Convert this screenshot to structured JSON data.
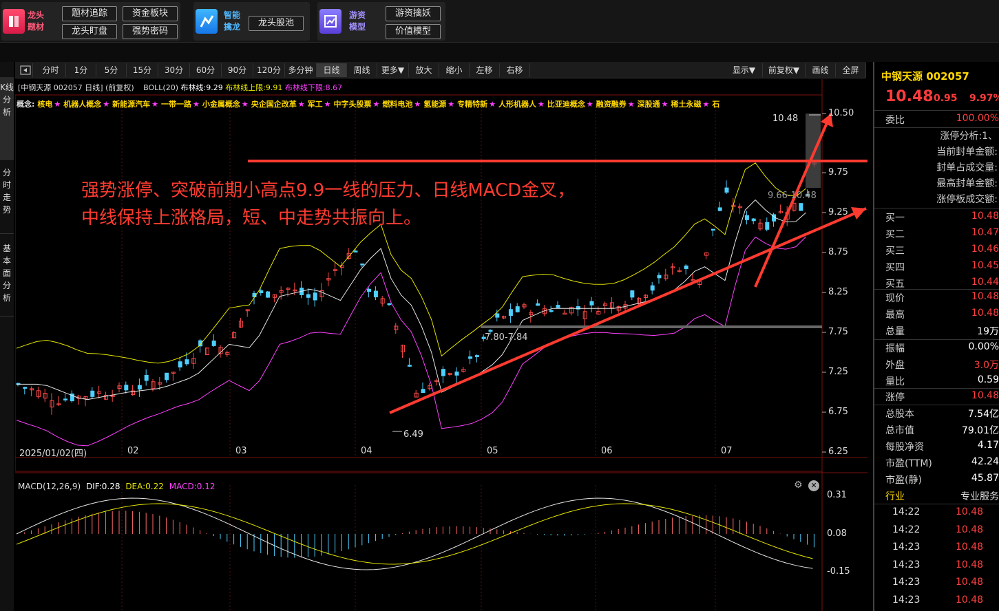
{
  "topbar": {
    "groups": [
      {
        "title": "龙头题材",
        "buttons": [
          "题材追踪",
          "资金板块",
          "龙头盯盘",
          "强势密码"
        ]
      },
      {
        "title": "智能擒龙",
        "buttons": [
          "龙头股池"
        ]
      },
      {
        "title": "游资模型",
        "buttons": [
          "游资擒妖",
          "价值模型"
        ]
      }
    ]
  },
  "sidetabs": [
    "K线分析",
    "分时走势",
    "基本面分析"
  ],
  "toolbar": {
    "left": [
      "分时",
      "1分",
      "5分",
      "15分",
      "30分",
      "60分",
      "90分",
      "120分",
      "多分钟",
      "日线",
      "周线",
      "更多▼",
      "放大",
      "缩小",
      "左移",
      "右移"
    ],
    "right": [
      "显示▼",
      "前复权▼",
      "画线",
      "全屏"
    ],
    "active": "日线"
  },
  "chart_info": {
    "header": "[中钢天源 002057 日线]  (前复权)",
    "boll": "BOLL(20)",
    "mid": "布林线:9.29",
    "upper": "布林线上限:9.91",
    "lower": "布林线下限:8.67"
  },
  "concepts": {
    "label": "概念:",
    "items": [
      "核电",
      "机器人概念",
      "新能源汽车",
      "一带一路",
      "小金属概念",
      "央企国企改革",
      "军工",
      "中字头股票",
      "燃料电池",
      "氢能源",
      "专精特新",
      "人形机器人",
      "比亚迪概念",
      "融资融券",
      "深股通",
      "稀土永磁",
      "石"
    ]
  },
  "annotation": {
    "line1": "强势涨停、突破前期小高点9.9一线的压力、日线MACD金叉，",
    "line2": "中线保持上涨格局，短、中走势共振向上。"
  },
  "price_labels": {
    "high": "10.48",
    "low": "6.49",
    "zone": "7.80-7.84",
    "ghost": "9.66-10.48"
  },
  "xaxis": {
    "first": "2025/01/02(四)",
    "months": [
      "02",
      "03",
      "04",
      "05",
      "06",
      "07"
    ]
  },
  "yaxis": [
    "10.50",
    "9.75",
    "9.25",
    "8.75",
    "8.25",
    "7.75",
    "7.25",
    "6.75",
    "6.25"
  ],
  "macd": {
    "label": "MACD(12,26,9)",
    "dif": "DIF:0.28",
    "dea": "DEA:0.22",
    "macd": "MACD:0.12",
    "ticks": [
      "0.31",
      "0.08",
      "-0.15"
    ]
  },
  "quote": {
    "name": "中钢天源 002057",
    "price": "10.48",
    "change": "0.95",
    "pct": "9.97%",
    "weibi_label": "委比",
    "weibi": "100.00%",
    "limit_lines": [
      "涨停分析:1、",
      "当前封单金额:",
      "封单占成交量:",
      "最高封单金额:",
      "涨停板成交额:"
    ],
    "book": [
      {
        "l": "买一",
        "v": "10.48"
      },
      {
        "l": "买二",
        "v": "10.47"
      },
      {
        "l": "买三",
        "v": "10.46"
      },
      {
        "l": "买四",
        "v": "10.45"
      },
      {
        "l": "买五",
        "v": "10.44"
      }
    ],
    "stats1": [
      {
        "l": "现价",
        "v": "10.48",
        "c": "#ff4040"
      },
      {
        "l": "最高",
        "v": "10.48",
        "c": "#ff4040"
      },
      {
        "l": "总量",
        "v": "19万",
        "c": "#ffffff"
      }
    ],
    "stats2": [
      {
        "l": "振幅",
        "v": "0.00%",
        "c": "#ffffff"
      },
      {
        "l": "外盘",
        "v": "3.0万",
        "c": "#ff4040"
      },
      {
        "l": "量比",
        "v": "0.59",
        "c": "#ffffff"
      }
    ],
    "stats3": [
      {
        "l": "涨停",
        "v": "10.48",
        "c": "#ff4040"
      }
    ],
    "fund": [
      {
        "l": "总股本",
        "v": "7.54亿"
      },
      {
        "l": "总市值",
        "v": "79.01亿"
      },
      {
        "l": "每股净资",
        "v": "4.17"
      },
      {
        "l": "市盈(TTM)",
        "v": "42.24"
      },
      {
        "l": "市盈(静)",
        "v": "45.87"
      }
    ],
    "industry_label": "行业",
    "industry": "专业服务",
    "ticks": [
      {
        "t": "14:22",
        "p": "10.48"
      },
      {
        "t": "14:22",
        "p": "10.48"
      },
      {
        "t": "14:23",
        "p": "10.48"
      },
      {
        "t": "14:23",
        "p": "10.48"
      },
      {
        "t": "14:23",
        "p": "10.48"
      },
      {
        "t": "14:23",
        "p": "10.48"
      }
    ]
  }
}
